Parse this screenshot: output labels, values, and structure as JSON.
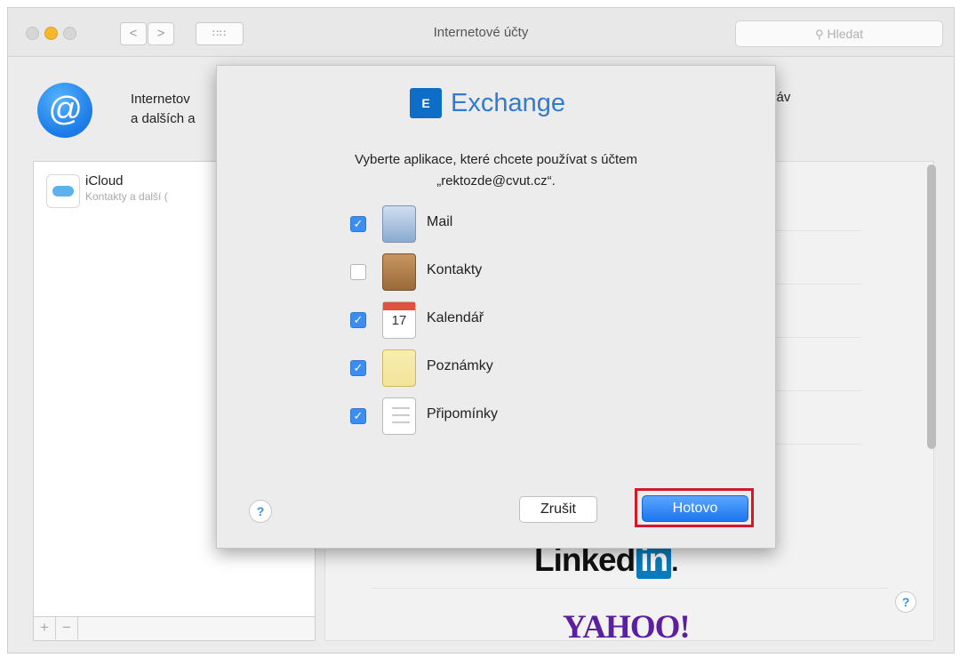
{
  "window": {
    "title": "Internetové účty",
    "search_placeholder": "Hledat",
    "nav_back": "<",
    "nav_forward": ">",
    "grid_glyph": "∷∷"
  },
  "header": {
    "icon": "at-sign-icon",
    "line1": "Internetov",
    "line2": "a dalších a",
    "right_text": "Zpráv"
  },
  "accounts": [
    {
      "name": "iCloud",
      "detail": "Kontakty a další ("
    }
  ],
  "list_controls": {
    "add": "+",
    "remove": "−"
  },
  "providers": {
    "linkedin_word": "Linked",
    "linkedin_in": "in",
    "linkedin_dot": ".",
    "yahoo": "YAHOO!"
  },
  "dialog": {
    "logo_text": "Exchange",
    "logo_badge": "E",
    "prompt_line1": "Vyberte aplikace, které chcete používat s účtem",
    "prompt_line2": "„rektozde@cvut.cz“.",
    "apps": [
      {
        "label": "Mail",
        "checked": true,
        "icon": "mail-icon"
      },
      {
        "label": "Kontakty",
        "checked": false,
        "icon": "contacts-icon"
      },
      {
        "label": "Kalendář",
        "checked": true,
        "icon": "calendar-icon",
        "calendar_day": "17"
      },
      {
        "label": "Poznámky",
        "checked": true,
        "icon": "notes-icon"
      },
      {
        "label": "Připomínky",
        "checked": true,
        "icon": "reminders-icon"
      }
    ],
    "cancel_label": "Zrušit",
    "done_label": "Hotovo",
    "help": "?"
  },
  "main_help": "?",
  "colors": {
    "accent": "#1d75ef",
    "highlight_frame": "#d6172a",
    "exchange_blue": "#2f7bd3"
  }
}
